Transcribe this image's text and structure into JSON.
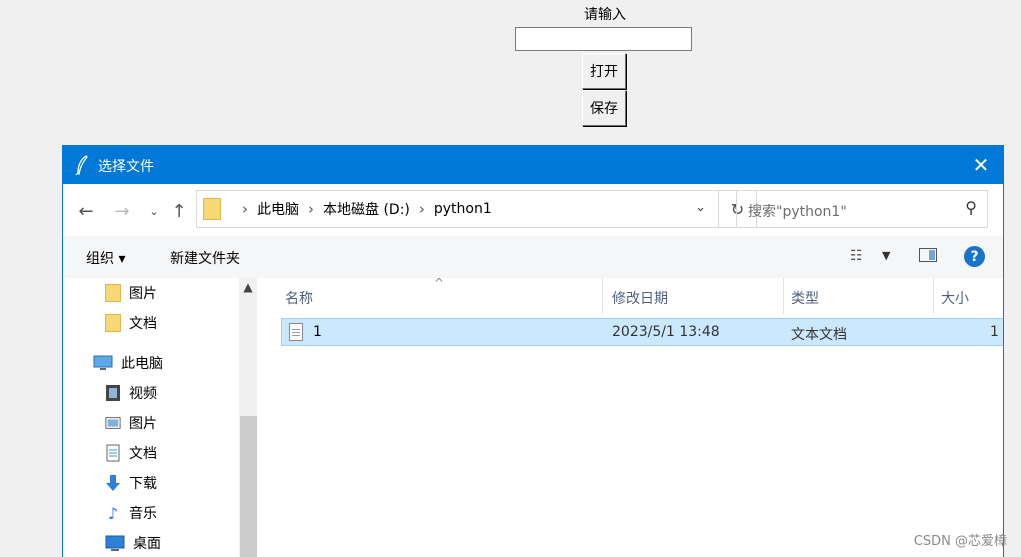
{
  "tk": {
    "label": "请输入",
    "entry_value": "",
    "open_button": "打开",
    "save_button": "保存"
  },
  "dialog": {
    "title": "选择文件",
    "close_glyph": "✕",
    "address": {
      "crumbs": [
        "此电脑",
        "本地磁盘 (D:)",
        "python1"
      ]
    },
    "search_placeholder": "搜索\"python1\"",
    "commands": {
      "organize": "组织 ▾",
      "new_folder": "新建文件夹"
    },
    "nav_items": [
      {
        "label": "图片",
        "icon": "folder-icon"
      },
      {
        "label": "文档",
        "icon": "folder-icon"
      },
      {
        "label": "此电脑",
        "icon": "computer-icon"
      },
      {
        "label": "视频",
        "icon": "video-icon"
      },
      {
        "label": "图片",
        "icon": "pictures-icon"
      },
      {
        "label": "文档",
        "icon": "documents-icon"
      },
      {
        "label": "下载",
        "icon": "download-icon"
      },
      {
        "label": "音乐",
        "icon": "music-icon"
      },
      {
        "label": "桌面",
        "icon": "desktop-icon"
      }
    ],
    "columns": [
      "名称",
      "修改日期",
      "类型",
      "大小"
    ],
    "files": [
      {
        "name": "1",
        "modified": "2023/5/1 13:48",
        "type": "文本文档",
        "size": "1"
      }
    ]
  },
  "watermark": "CSDN @芯爱樟",
  "colors": {
    "titlebar": "#0078d7",
    "selection": "#cce8ff",
    "accent_help": "#1a73c8"
  }
}
